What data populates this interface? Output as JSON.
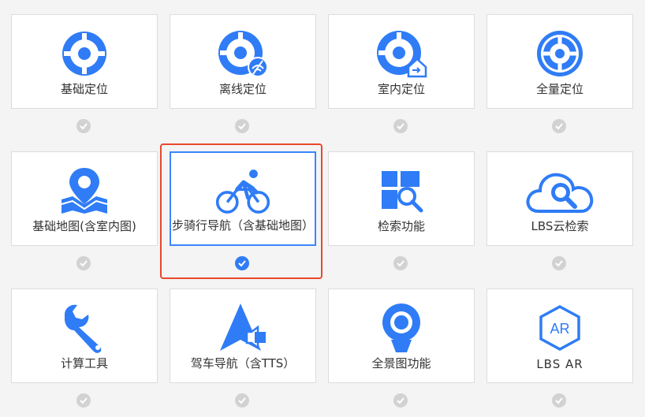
{
  "colors": {
    "accent": "#2f7cf6",
    "check_off": "#d2d2d2",
    "highlight": "#e8492b"
  },
  "features": [
    {
      "label": "基础定位",
      "icon": "location-target-icon",
      "checked": false
    },
    {
      "label": "离线定位",
      "icon": "offline-location-icon",
      "checked": false
    },
    {
      "label": "室内定位",
      "icon": "indoor-location-icon",
      "checked": false
    },
    {
      "label": "全量定位",
      "icon": "full-location-icon",
      "checked": false
    },
    {
      "label": "基础地图(含室内图)",
      "icon": "map-pin-icon",
      "checked": false
    },
    {
      "label": "步骑行导航（含基础地图）",
      "icon": "bicycle-rider-icon",
      "checked": true
    },
    {
      "label": "检索功能",
      "icon": "search-grid-icon",
      "checked": false
    },
    {
      "label": "LBS云检索",
      "icon": "cloud-search-icon",
      "checked": false
    },
    {
      "label": "计算工具",
      "icon": "wrench-icon",
      "checked": false
    },
    {
      "label": "驾车导航（含TTS）",
      "icon": "car-navigation-icon",
      "checked": false
    },
    {
      "label": "全景图功能",
      "icon": "panorama-camera-icon",
      "checked": false
    },
    {
      "label": "LBS AR",
      "icon": "ar-icon",
      "checked": false
    }
  ]
}
